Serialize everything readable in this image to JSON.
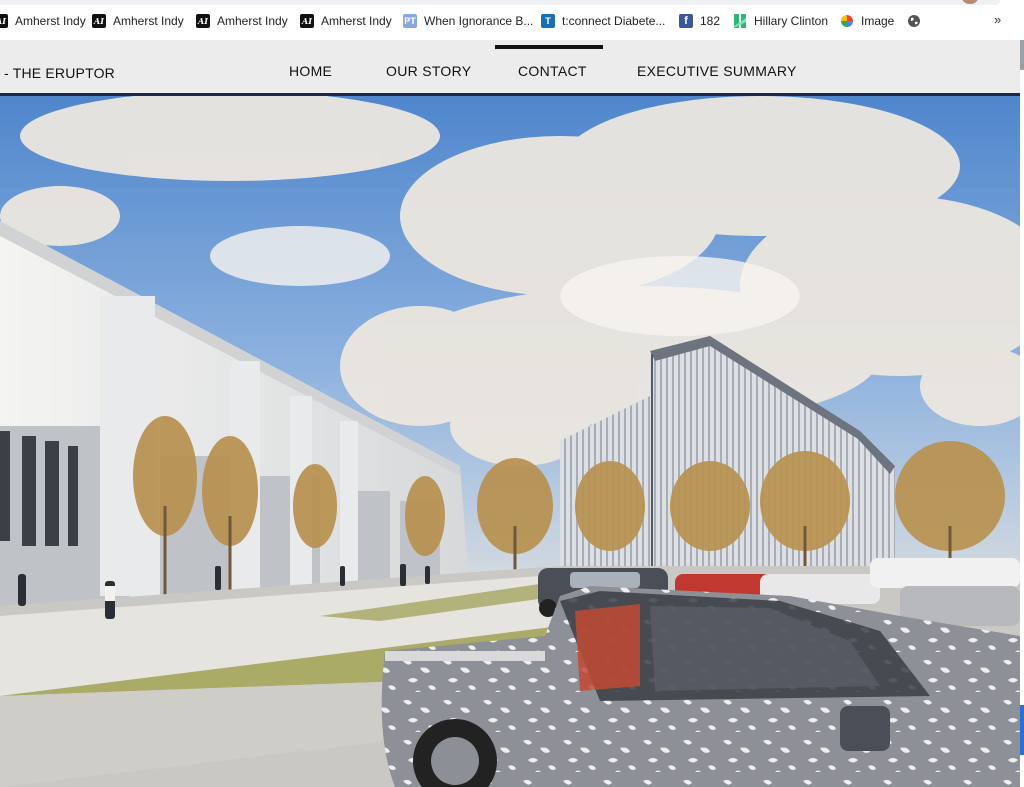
{
  "bookmarks": [
    {
      "label": "Amherst Indy",
      "icon": "amherst-indy-favicon"
    },
    {
      "label": "Amherst Indy",
      "icon": "amherst-indy-favicon"
    },
    {
      "label": "Amherst Indy",
      "icon": "amherst-indy-favicon"
    },
    {
      "label": "Amherst Indy",
      "icon": "amherst-indy-favicon"
    },
    {
      "label": "When Ignorance B...",
      "icon": "pt-favicon"
    },
    {
      "label": "t:connect Diabete...",
      "icon": "tconnect-favicon"
    },
    {
      "label": "182",
      "icon": "facebook-favicon"
    },
    {
      "label": "Hillary Clinton",
      "icon": "hillary-favicon"
    },
    {
      "label": "Image",
      "icon": "google-photos-favicon"
    },
    {
      "label": "",
      "icon": "globe-icon"
    }
  ],
  "bookmarks_overflow": "»",
  "site": {
    "brand": "- THE ERUPTOR",
    "nav": [
      "HOME",
      "OUR STORY",
      "CONTACT",
      "EXECUTIVE SUMMARY"
    ],
    "active_nav": "CONTACT"
  },
  "hero": {
    "type": "architectural rendering",
    "colors": {
      "sky": "#5d8fd1",
      "cloud": "#e9e4dc",
      "grass": "#a9ab66",
      "road": "#c9c8c4"
    }
  },
  "colors": {
    "nav_bg": "#ececec",
    "nav_border": "#1e2a44",
    "text": "#111111"
  }
}
